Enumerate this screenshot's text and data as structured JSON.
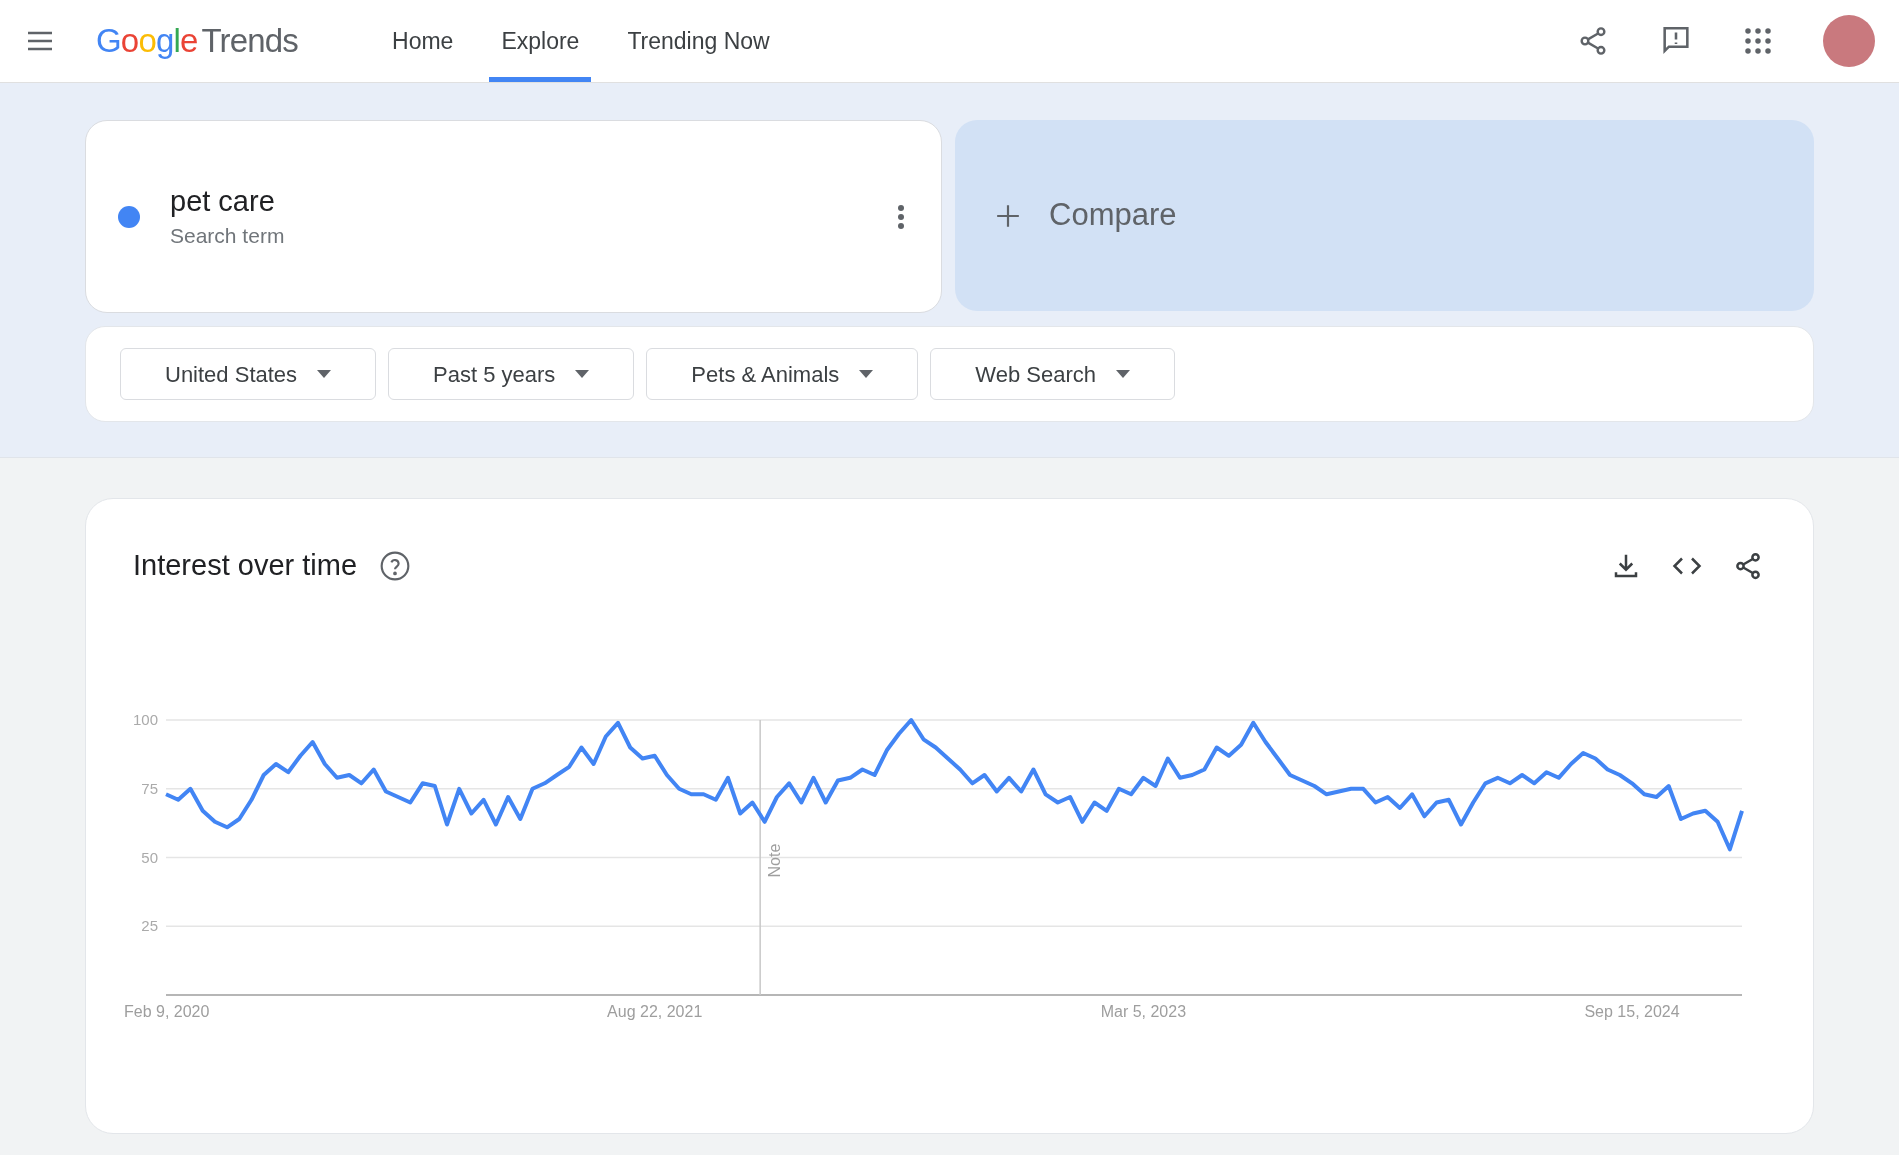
{
  "header": {
    "logo": {
      "brand": "Google",
      "product": "Trends"
    },
    "nav": [
      {
        "label": "Home",
        "selected": false
      },
      {
        "label": "Explore",
        "selected": true
      },
      {
        "label": "Trending Now",
        "selected": false
      }
    ]
  },
  "search_term": {
    "term": "pet care",
    "subtitle": "Search term",
    "color": "#4285f4"
  },
  "compare": {
    "label": "Compare"
  },
  "filters": [
    {
      "label": "United States"
    },
    {
      "label": "Past 5 years"
    },
    {
      "label": "Pets & Animals"
    },
    {
      "label": "Web Search"
    }
  ],
  "interest_over_time": {
    "title": "Interest over time",
    "chart_data": {
      "type": "line",
      "grid": true,
      "ylim": [
        0,
        100
      ],
      "yticks": [
        25,
        50,
        75,
        100
      ],
      "categories": [
        "Feb 9, 2020",
        null,
        null,
        null,
        null,
        null,
        null,
        null,
        null,
        null,
        null,
        null,
        null,
        null,
        null,
        null,
        null,
        null,
        null,
        null,
        null,
        null,
        null,
        null,
        null,
        null,
        null,
        null,
        null,
        null,
        null,
        null,
        null,
        null,
        null,
        null,
        null,
        null,
        null,
        null,
        "Aug 22, 2021",
        null,
        null,
        null,
        null,
        null,
        null,
        null,
        null,
        null,
        null,
        null,
        null,
        null,
        null,
        null,
        null,
        null,
        null,
        null,
        null,
        null,
        null,
        null,
        null,
        null,
        null,
        null,
        null,
        null,
        null,
        null,
        null,
        null,
        null,
        null,
        null,
        null,
        null,
        null,
        "Mar 5, 2023",
        null,
        null,
        null,
        null,
        null,
        null,
        null,
        null,
        null,
        null,
        null,
        null,
        null,
        null,
        null,
        null,
        null,
        null,
        null,
        null,
        null,
        null,
        null,
        null,
        null,
        null,
        null,
        null,
        null,
        null,
        null,
        null,
        null,
        null,
        null,
        null,
        null,
        null,
        null,
        "Sep 15, 2024",
        null,
        null,
        null,
        null,
        null,
        null,
        null,
        null,
        null
      ],
      "annotations": [
        "Note"
      ],
      "series": [
        {
          "color": "#4285f4",
          "values": [
            73,
            71,
            75,
            67,
            63,
            61,
            64,
            71,
            80,
            84,
            81,
            87,
            92,
            84,
            79,
            80,
            77,
            82,
            74,
            72,
            70,
            77,
            76,
            62,
            75,
            66,
            71,
            62,
            72,
            64,
            75,
            77,
            80,
            83,
            90,
            84,
            94,
            99,
            90,
            86,
            87,
            80,
            75,
            73,
            73,
            71,
            79,
            66,
            70,
            63,
            72,
            77,
            70,
            79,
            70,
            78,
            79,
            82,
            80,
            89,
            95,
            100,
            93,
            90,
            86,
            82,
            77,
            80,
            74,
            79,
            74,
            82,
            73,
            70,
            72,
            63,
            70,
            67,
            75,
            73,
            79,
            76,
            86,
            79,
            80,
            82,
            90,
            87,
            91,
            99,
            92,
            86,
            80,
            78,
            76,
            73,
            74,
            75,
            75,
            70,
            72,
            68,
            73,
            65,
            70,
            71,
            62,
            70,
            77,
            79,
            77,
            80,
            77,
            81,
            79,
            84,
            88,
            86,
            82,
            80,
            77,
            73,
            72,
            76,
            64,
            66,
            67,
            63,
            53,
            67
          ]
        }
      ]
    }
  }
}
